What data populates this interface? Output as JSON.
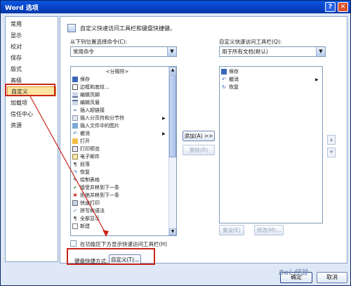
{
  "window": {
    "title": "Word 选项",
    "help_glyph": "?",
    "close_glyph": "✕"
  },
  "nav": {
    "items": [
      {
        "label": "常用"
      },
      {
        "label": "显示"
      },
      {
        "label": "校对"
      },
      {
        "label": "保存"
      },
      {
        "label": "版式"
      },
      {
        "label": "高级"
      },
      {
        "label": "自定义",
        "active": true
      },
      {
        "label": "加载项"
      },
      {
        "label": "信任中心"
      },
      {
        "label": "资源"
      }
    ]
  },
  "main": {
    "header": "自定义快速访问工具栏和键盘快捷键。",
    "left_label": "从下列位置选择命令(C):",
    "left_combo_value": "常用命令",
    "right_label": "自定义快速访问工具栏(Q):",
    "right_combo_value": "用于所有文档(默认)",
    "commands": [
      {
        "label": "<分隔符>",
        "separator": true
      },
      {
        "label": "保存",
        "icon": "floppy-icon"
      },
      {
        "label": "边框和底纹...",
        "icon": "border-icon"
      },
      {
        "label": "编辑页脚",
        "icon": "footer-icon"
      },
      {
        "label": "编辑页眉",
        "icon": "header-icon"
      },
      {
        "label": "插入超链接",
        "icon": "hyperlink-icon"
      },
      {
        "label": "插入分页符和分节符",
        "icon": "page-break-icon",
        "submenu": true
      },
      {
        "label": "插入文件中的图片",
        "icon": "picture-icon"
      },
      {
        "label": "撤消",
        "icon": "undo-icon",
        "submenu": true
      },
      {
        "label": "打开",
        "icon": "open-folder-icon"
      },
      {
        "label": "打印预览",
        "icon": "print-preview-icon"
      },
      {
        "label": "电子邮件",
        "icon": "email-icon"
      },
      {
        "label": "段落",
        "icon": "paragraph-icon"
      },
      {
        "label": "恢复",
        "icon": "redo-icon"
      },
      {
        "label": "绘制表格",
        "icon": "draw-table-icon"
      },
      {
        "label": "接受并移到下一条",
        "icon": "accept-change-icon"
      },
      {
        "label": "拒绝并移到下一条",
        "icon": "reject-change-icon"
      },
      {
        "label": "快速打印",
        "icon": "quick-print-icon"
      },
      {
        "label": "拼写和语法",
        "icon": "spelling-icon"
      },
      {
        "label": "全部显示",
        "icon": "show-all-icon"
      },
      {
        "label": "新建",
        "icon": "new-document-icon"
      }
    ],
    "qat_items": [
      {
        "label": "保存",
        "icon": "floppy-icon"
      },
      {
        "label": "撤消",
        "icon": "undo-icon",
        "submenu": true
      },
      {
        "label": "恢复",
        "icon": "redo-icon"
      }
    ],
    "add_button": "添加(A) >>",
    "remove_button": "删除(R)",
    "reset_button": "重设(E)",
    "modify_button": "修改(M)...",
    "checkbox_label": "在功能区下方显示快速访问工具栏(H)",
    "keyboard_label": "键盘快捷方式:",
    "customize_button": "自定义(T)...",
    "ok_button": "确定",
    "cancel_button": "取消"
  },
  "watermark": "Bai 经验",
  "colors": {
    "highlight": "#c8261b",
    "active_nav": "#fde4a0",
    "titlebar": "#0a58e0"
  }
}
